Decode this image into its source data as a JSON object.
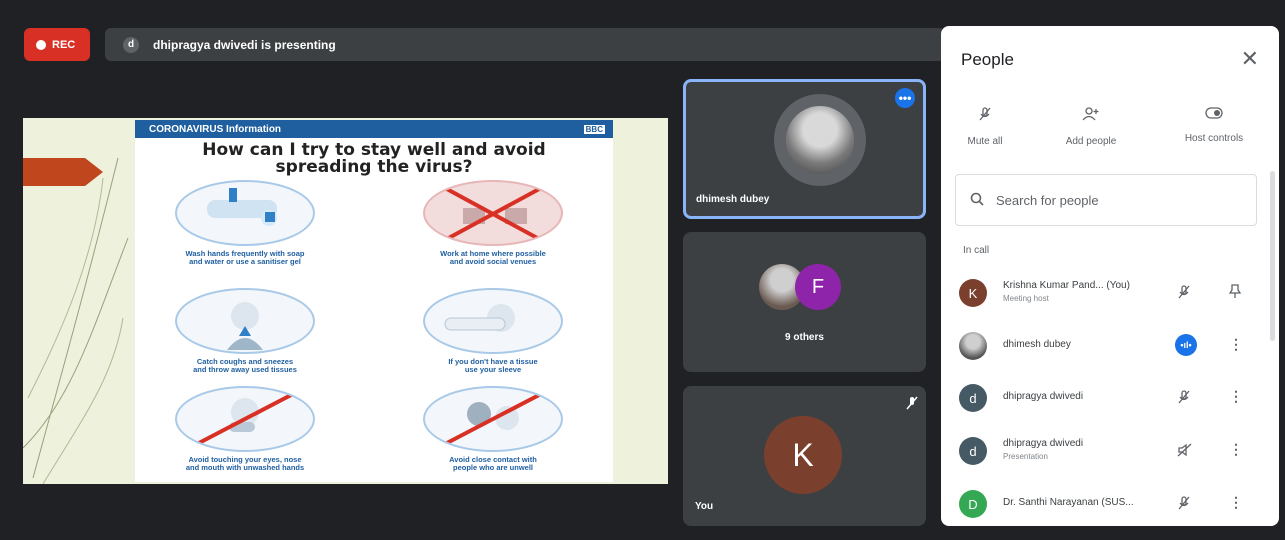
{
  "recording": {
    "label": "REC",
    "color": "#d93025"
  },
  "presenting_bar": {
    "avatar_letter": "d",
    "text": "dhipragya dwivedi is presenting"
  },
  "slide": {
    "header_left": "CORONAVIRUS Information",
    "header_right": "BBC",
    "title_line1": "How can I try to stay well and avoid",
    "title_line2": "spreading the virus?",
    "tips": [
      {
        "line1": "Wash hands frequently with soap",
        "line2": "and water or use a sanitiser gel"
      },
      {
        "line1": "Work at home where possible",
        "line2": "and avoid social venues"
      },
      {
        "line1": "Catch coughs and sneezes",
        "line2": "and throw away used tissues"
      },
      {
        "line1": "If you don't have a tissue",
        "line2": "use your sleeve"
      },
      {
        "line1": "Avoid touching your eyes, nose",
        "line2": "and mouth with unwashed hands"
      },
      {
        "line1": "Avoid close contact with",
        "line2": "people who are unwell"
      }
    ]
  },
  "tiles": {
    "main": {
      "name": "dhimesh dubey",
      "menu_glyph": "•••"
    },
    "others": {
      "avatar_letter": "F",
      "label": "9 others"
    },
    "self": {
      "avatar_letter": "K",
      "label": "You"
    }
  },
  "people_panel": {
    "title": "People",
    "actions": [
      {
        "label": "Mute all",
        "icon": "mic-off-icon"
      },
      {
        "label": "Add people",
        "icon": "add-person-icon"
      },
      {
        "label": "Host controls",
        "icon": "toggle-icon"
      }
    ],
    "search_placeholder": "Search for people",
    "section_label": "In call",
    "participants": [
      {
        "avatar": "K",
        "avatar_color": "#7b3f2e",
        "name": "Krishna Kumar Pand... (You)",
        "subtitle": "Meeting host"
      },
      {
        "avatar": "",
        "avatar_color": "#555555",
        "name": "dhimesh dubey",
        "subtitle": ""
      },
      {
        "avatar": "d",
        "avatar_color": "#455a64",
        "name": "dhipragya dwivedi",
        "subtitle": ""
      },
      {
        "avatar": "d",
        "avatar_color": "#455a64",
        "name": "dhipragya dwivedi",
        "subtitle": "Presentation"
      },
      {
        "avatar": "D",
        "avatar_color": "#34a853",
        "name": "Dr. Santhi Narayanan (SUS...",
        "subtitle": ""
      }
    ]
  }
}
